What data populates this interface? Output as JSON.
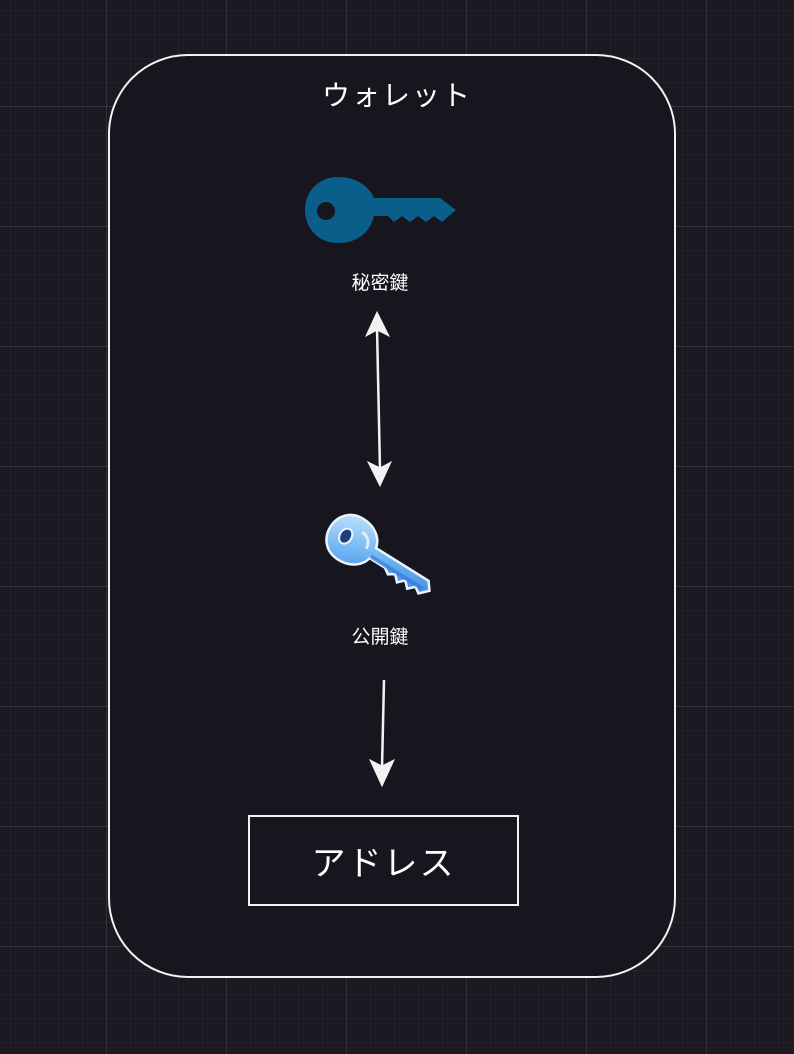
{
  "wallet": {
    "title": "ウォレット"
  },
  "nodes": {
    "private_key": {
      "label": "秘密鍵",
      "icon": "key-icon",
      "color": "#0a5f8a"
    },
    "public_key": {
      "label": "公開鍵",
      "icon": "key-icon",
      "color": "#5aa8f0"
    },
    "address": {
      "label": "アドレス"
    }
  },
  "edges": [
    {
      "from": "private_key",
      "to": "public_key",
      "direction": "both"
    },
    {
      "from": "public_key",
      "to": "address",
      "direction": "forward"
    }
  ],
  "colors": {
    "background": "#1b1921",
    "panel": "#17151d",
    "stroke": "#f2f2f2"
  }
}
